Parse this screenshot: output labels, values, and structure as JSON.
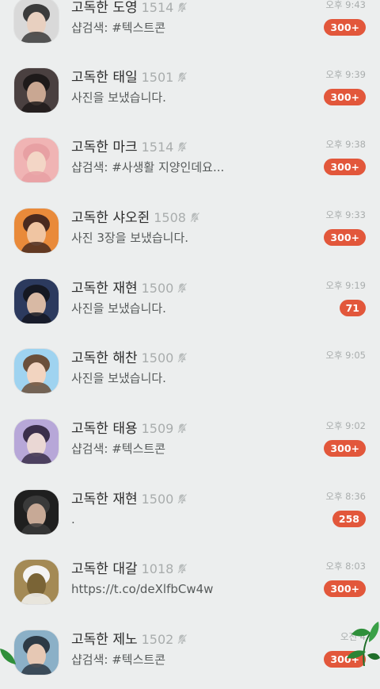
{
  "chats": [
    {
      "name": "고독한 도영",
      "count": "1514",
      "message": "샵검색: #텍스트콘",
      "time": "오후 9:43",
      "badge": "300+",
      "colors": [
        "#d9d9d9",
        "#3b3b3b",
        "#e8d0c0"
      ]
    },
    {
      "name": "고독한 태일",
      "count": "1501",
      "message": "사진을 보냈습니다.",
      "time": "오후 9:39",
      "badge": "300+",
      "colors": [
        "#4a4040",
        "#1e1a1a",
        "#c9a792"
      ]
    },
    {
      "name": "고독한 마크",
      "count": "1514",
      "message": "샵검색: #사생활 지양인데요...",
      "time": "오후 9:38",
      "badge": "300+",
      "colors": [
        "#f0b4b4",
        "#e7a0a3",
        "#f3d6c6"
      ]
    },
    {
      "name": "고독한 샤오쥔",
      "count": "1508",
      "message": "사진 3장을 보냈습니다.",
      "time": "오후 9:33",
      "badge": "300+",
      "colors": [
        "#e98a3a",
        "#4a2a1f",
        "#f0c5a2"
      ]
    },
    {
      "name": "고독한 재현",
      "count": "1500",
      "message": "사진을 보냈습니다.",
      "time": "오후 9:19",
      "badge": "71",
      "colors": [
        "#2c3a5e",
        "#151822",
        "#d8b9a4"
      ]
    },
    {
      "name": "고독한 해찬",
      "count": "1500",
      "message": "사진을 보냈습니다.",
      "time": "오후 9:05",
      "badge": "",
      "colors": [
        "#9fd3f0",
        "#6b4f3a",
        "#f2d4c0"
      ]
    },
    {
      "name": "고독한 태용",
      "count": "1509",
      "message": "샵검색: #텍스트콘",
      "time": "오후 9:02",
      "badge": "300+",
      "colors": [
        "#b7a7d8",
        "#3a2e4a",
        "#ead7d4"
      ]
    },
    {
      "name": "고독한 재현",
      "count": "1500",
      "message": ".",
      "time": "오후 8:36",
      "badge": "258",
      "colors": [
        "#1f1f1f",
        "#3a3a3a",
        "#c7a996"
      ]
    },
    {
      "name": "고독한 대갈",
      "count": "1018",
      "message": "https://t.co/deXlfbCw4w",
      "time": "오후 8:03",
      "badge": "300+",
      "colors": [
        "#a48a55",
        "#f4f4f4",
        "#7a6436"
      ]
    },
    {
      "name": "고독한 제노",
      "count": "1502",
      "message": "샵검색: #텍스트콘",
      "time": "오전 4",
      "badge": "300+",
      "colors": [
        "#8bb0c7",
        "#2d3a45",
        "#e6c8b4"
      ]
    }
  ],
  "accent": "#e2573b"
}
